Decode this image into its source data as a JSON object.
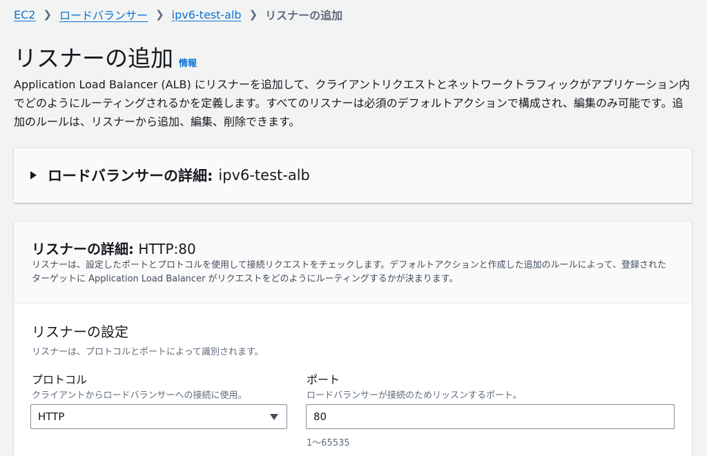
{
  "breadcrumb": {
    "items": [
      "EC2",
      "ロードバランサー",
      "ipv6-test-alb"
    ],
    "current": "リスナーの追加"
  },
  "page": {
    "title": "リスナーの追加",
    "info": "情報",
    "description": "Application Load Balancer (ALB) にリスナーを追加して、クライアントリクエストとネットワークトラフィックがアプリケーション内でどのようにルーティングされるかを定義します。すべてのリスナーは必須のデフォルトアクションで構成され、編集のみ可能です。追加のルールは、リスナーから追加、編集、削除できます。"
  },
  "lb_details": {
    "title": "ロードバランサーの詳細:",
    "value": "ipv6-test-alb"
  },
  "listener_details": {
    "title": "リスナーの詳細:",
    "value": "HTTP:80",
    "description": "リスナーは、設定したポートとプロトコルを使用して接続リクエストをチェックします。デフォルトアクションと作成した追加のルールによって、登録されたターゲットに Application Load Balancer がリクエストをどのようにルーティングするかが決まります。"
  },
  "listener_config": {
    "title": "リスナーの設定",
    "description": "リスナーは、プロトコルとポートによって識別されます。",
    "protocol": {
      "label": "プロトコル",
      "description": "クライアントからロードバランサーへの接続に使用。",
      "value": "HTTP"
    },
    "port": {
      "label": "ポート",
      "description": "ロードバランサーが接続のためリッスンするポート。",
      "value": "80",
      "constraint": "1〜65535"
    }
  },
  "colors": {
    "link": "#0972d3",
    "background": "#f2f3f3",
    "text": "#16191f"
  }
}
